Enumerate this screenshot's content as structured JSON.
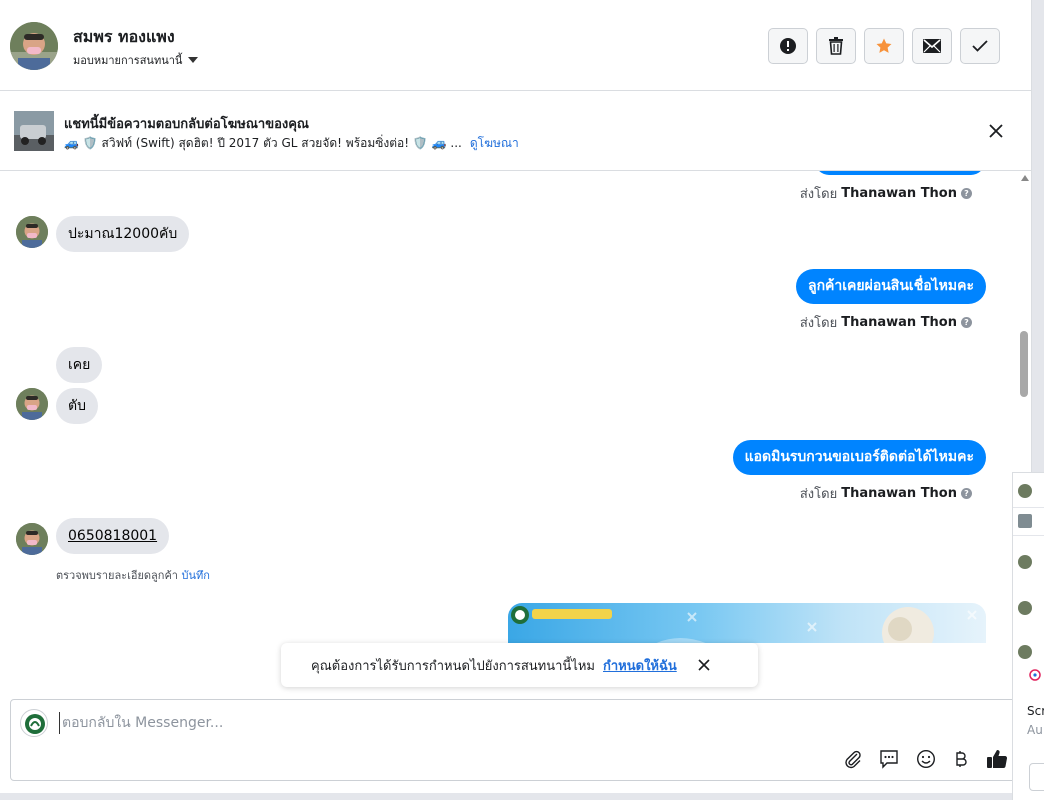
{
  "header": {
    "name": "สมพร ทองแพง",
    "assign_label": "มอบหมายการสนทนานี้",
    "actions": [
      "spam-icon",
      "trash-icon",
      "star-icon",
      "mail-icon",
      "check-icon"
    ],
    "star_color": "#f7923b"
  },
  "ad_banner": {
    "title": "แชทนี้มีข้อความตอบกลับต่อโฆษณาของคุณ",
    "subtitle": "🚙 🛡️ สวิฟท์ (Swift) สุดฮิต! ปี 2017 ตัว GL สวยจัด! พร้อมซิ่งต่อ! 🛡️ 🚙 ...",
    "link": "ดูโฆษณา"
  },
  "messages": {
    "sent_by_prefix": "ส่งโดย",
    "sender_name": "Thanawan Thon",
    "help_mark": "?",
    "incoming_1": "ปะมาณ12000คับ",
    "outgoing_1": "ลูกค้าเคยผ่อนสินเชื่อไหมคะ",
    "incoming_2a": "เคย",
    "incoming_2b": "ตับ",
    "outgoing_2": "แอดมินรบกวนขอเบอร์ติดต่อได้ไหมคะ",
    "incoming_3": "0650818001",
    "detected_note": "ตรวจพบรายละเอียดลูกค้า",
    "detected_link": "บันทึก"
  },
  "toast": {
    "text": "คุณต้องการได้รับการกำหนดไปยังการสนทนานี้ไหม",
    "link": "กำหนดให้ฉัน"
  },
  "composer": {
    "placeholder": "ตอบกลับใน Messenger...",
    "tools": [
      "attach-icon",
      "saved-reply-icon",
      "emoji-icon",
      "baht-icon",
      "like-icon"
    ],
    "accent": "#0084ff"
  },
  "side_panel": {
    "snippets": [
      "Scr",
      "Au"
    ]
  }
}
